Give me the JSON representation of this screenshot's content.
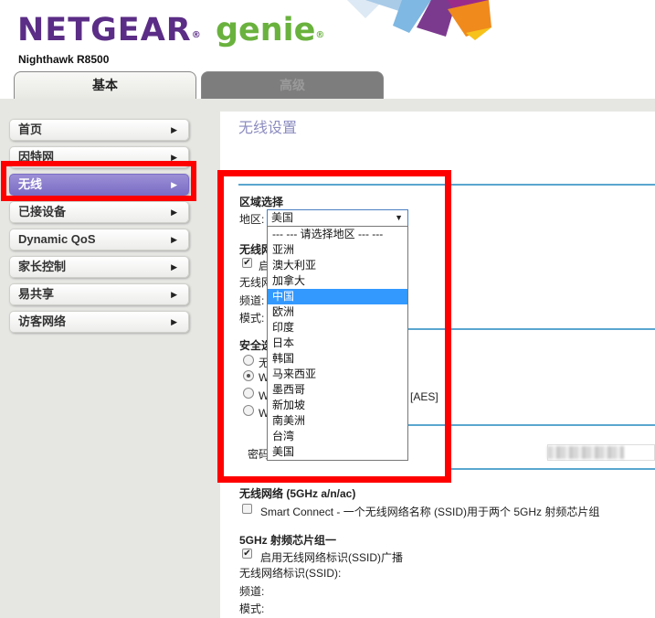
{
  "brand": {
    "name": "NETGEAR",
    "product": "genie",
    "registered": "®",
    "model": "Nighthawk R8500"
  },
  "tabs": {
    "basic": "基本",
    "advanced": "高级"
  },
  "sidebar": {
    "items": [
      {
        "label": "首页"
      },
      {
        "label": "因特网"
      },
      {
        "label": "无线"
      },
      {
        "label": "已接设备"
      },
      {
        "label": "Dynamic QoS"
      },
      {
        "label": "家长控制"
      },
      {
        "label": "易共享"
      },
      {
        "label": "访客网络"
      }
    ],
    "arrow": "▶"
  },
  "main": {
    "title": "无线设置",
    "region": {
      "heading": "区域选择",
      "label": "地区:",
      "selected": "美国",
      "caret": "▼",
      "options": [
        "--- --- 请选择地区 --- ---",
        "亚洲",
        "澳大利亚",
        "加拿大",
        "中国",
        "欧洲",
        "印度",
        "日本",
        "韩国",
        "马来西亚",
        "墨西哥",
        "新加坡",
        "南美洲",
        "台湾",
        "美国"
      ],
      "highlighted_option": "中国"
    },
    "partial": {
      "wireless_net": "无线网",
      "enable_short": "启",
      "ssid_short": "无线网",
      "channel": "频道:",
      "mode": "模式:",
      "security": "安全选",
      "radio_none": "无",
      "radio_w1": "W",
      "radio_w2": "W",
      "radio_w3": "W",
      "aes": "[AES]",
      "password": "密码"
    },
    "net5g": {
      "heading": "无线网络 (5GHz a/n/ac)",
      "smart_connect": "Smart Connect - 一个无线网络名称 (SSID)用于两个 5GHz 射频芯片组"
    },
    "radio1": {
      "heading": "5GHz 射频芯片组一",
      "ssid_broadcast": "启用无线网络标识(SSID)广播",
      "ssid": "无线网络标识(SSID):",
      "channel": "频道:",
      "mode": "模式:"
    },
    "check_mark": "✔"
  },
  "colors": {
    "brand_purple": "#5b2d86",
    "genie_green": "#6ab23e",
    "active_nav": "#8a7ccd",
    "highlight_red": "#ff0000",
    "divider_blue": "#5aa6cf"
  }
}
